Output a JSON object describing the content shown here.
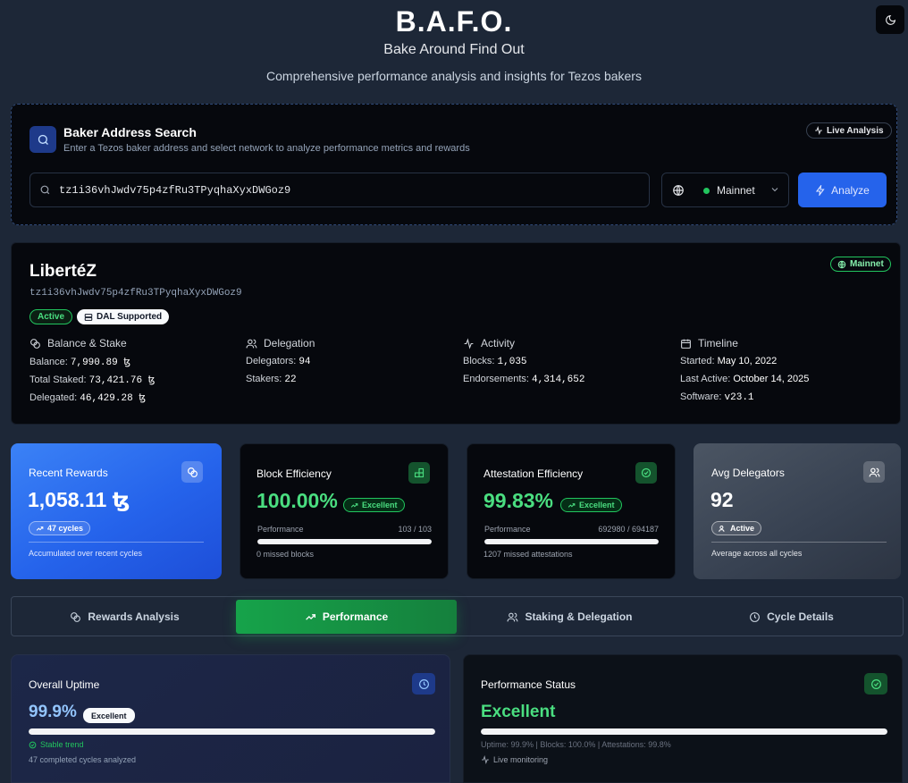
{
  "header": {
    "title": "B.A.F.O.",
    "tagline": "Bake Around Find Out",
    "description": "Comprehensive performance analysis and insights for Tezos bakers",
    "theme_icon": "moon-icon"
  },
  "search": {
    "title": "Baker Address Search",
    "subtitle": "Enter a Tezos baker address and select network to analyze performance metrics and rewards",
    "live_badge": "Live Analysis",
    "address_value": "tz1i36vhJwdv75p4zfRu3TPyqhaXyxDWGoz9",
    "network": "Mainnet",
    "analyze_label": "Analyze"
  },
  "baker": {
    "name": "LibertéZ",
    "address": "tz1i36vhJwdv75p4zfRu3TPyqhaXyxDWGoz9",
    "network_badge": "Mainnet",
    "status_badge": "Active",
    "dal_badge": "DAL Supported",
    "balance": {
      "heading": "Balance & Stake",
      "balance_label": "Balance:",
      "balance_value": "7,990.89 ꜩ",
      "staked_label": "Total Staked:",
      "staked_value": "73,421.76 ꜩ",
      "delegated_label": "Delegated:",
      "delegated_value": "46,429.28 ꜩ"
    },
    "delegation": {
      "heading": "Delegation",
      "delegators_label": "Delegators:",
      "delegators_value": "94",
      "stakers_label": "Stakers:",
      "stakers_value": "22"
    },
    "activity": {
      "heading": "Activity",
      "blocks_label": "Blocks:",
      "blocks_value": "1,035",
      "endorsements_label": "Endorsements:",
      "endorsements_value": "4,314,652"
    },
    "timeline": {
      "heading": "Timeline",
      "started_label": "Started:",
      "started_value": "May 10, 2022",
      "last_active_label": "Last Active:",
      "last_active_value": "October 14, 2025",
      "software_label": "Software:",
      "software_value": "v23.1"
    }
  },
  "stats": {
    "rewards": {
      "title": "Recent Rewards",
      "value": "1,058.11 ꜩ",
      "pill": "47 cycles",
      "sub": "Accumulated over recent cycles"
    },
    "block": {
      "title": "Block Efficiency",
      "value": "100.00%",
      "pill": "Excellent",
      "perf_label": "Performance",
      "perf_count": "103 / 103",
      "perf_fraction": 1.0,
      "sub": "0 missed blocks"
    },
    "attest": {
      "title": "Attestation Efficiency",
      "value": "99.83%",
      "pill": "Excellent",
      "perf_label": "Performance",
      "perf_count": "692980 / 694187",
      "perf_fraction": 0.9983,
      "sub": "1207 missed attestations"
    },
    "delegators": {
      "title": "Avg Delegators",
      "value": "92",
      "pill": "Active",
      "sub": "Average across all cycles"
    }
  },
  "tabs": [
    {
      "label": "Rewards Analysis",
      "icon": "coins-icon"
    },
    {
      "label": "Performance",
      "icon": "trending-up-icon"
    },
    {
      "label": "Staking & Delegation",
      "icon": "users-icon"
    },
    {
      "label": "Cycle Details",
      "icon": "clock-icon"
    }
  ],
  "uptime": {
    "title": "Overall Uptime",
    "value": "99.9%",
    "badge": "Excellent",
    "fraction": 0.999,
    "trend": "Stable trend",
    "note": "47 completed cycles analyzed"
  },
  "status": {
    "title": "Performance Status",
    "value": "Excellent",
    "fraction": 0.999,
    "summary": "Uptime: 99.9% | Blocks: 100.0% | Attestations: 99.8%",
    "monitoring": "Live monitoring"
  },
  "colors": {
    "accent_blue": "#2563eb",
    "success_green": "#22c55e",
    "excellent_text": "#4ade80",
    "uptime_text": "#93c5fd"
  }
}
